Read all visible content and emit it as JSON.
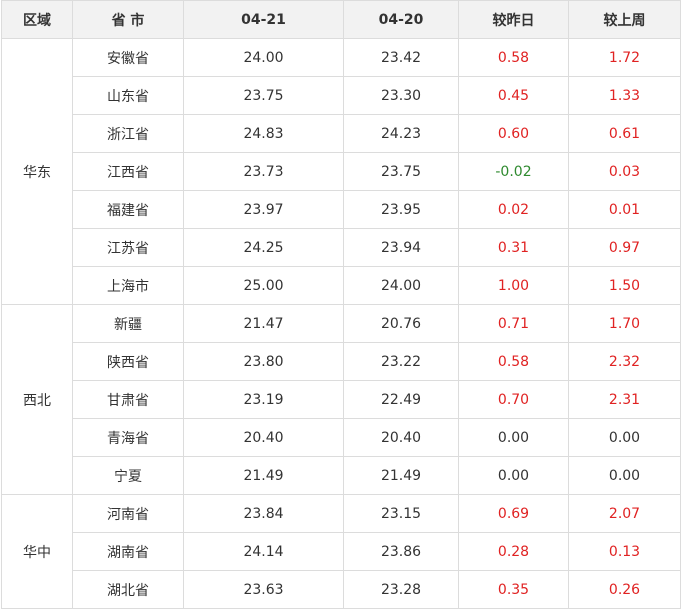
{
  "headers": [
    "区域",
    "省 市",
    "04-21",
    "04-20",
    "较昨日",
    "较上周"
  ],
  "colors": {
    "up": "#e02222",
    "down": "#2f8a2f",
    "flat": "#333333",
    "header_bg": "#f2f2f2",
    "border": "#dcdcdc"
  },
  "groups": [
    {
      "region": "华东",
      "rows": [
        {
          "province": "安徽省",
          "d0421": "24.00",
          "d0420": "23.42",
          "vs_yesterday": "0.58",
          "vs_last_week": "1.72"
        },
        {
          "province": "山东省",
          "d0421": "23.75",
          "d0420": "23.30",
          "vs_yesterday": "0.45",
          "vs_last_week": "1.33"
        },
        {
          "province": "浙江省",
          "d0421": "24.83",
          "d0420": "24.23",
          "vs_yesterday": "0.60",
          "vs_last_week": "0.61"
        },
        {
          "province": "江西省",
          "d0421": "23.73",
          "d0420": "23.75",
          "vs_yesterday": "-0.02",
          "vs_last_week": "0.03"
        },
        {
          "province": "福建省",
          "d0421": "23.97",
          "d0420": "23.95",
          "vs_yesterday": "0.02",
          "vs_last_week": "0.01"
        },
        {
          "province": "江苏省",
          "d0421": "24.25",
          "d0420": "23.94",
          "vs_yesterday": "0.31",
          "vs_last_week": "0.97"
        },
        {
          "province": "上海市",
          "d0421": "25.00",
          "d0420": "24.00",
          "vs_yesterday": "1.00",
          "vs_last_week": "1.50"
        }
      ]
    },
    {
      "region": "西北",
      "rows": [
        {
          "province": "新疆",
          "d0421": "21.47",
          "d0420": "20.76",
          "vs_yesterday": "0.71",
          "vs_last_week": "1.70"
        },
        {
          "province": "陕西省",
          "d0421": "23.80",
          "d0420": "23.22",
          "vs_yesterday": "0.58",
          "vs_last_week": "2.32"
        },
        {
          "province": "甘肃省",
          "d0421": "23.19",
          "d0420": "22.49",
          "vs_yesterday": "0.70",
          "vs_last_week": "2.31"
        },
        {
          "province": "青海省",
          "d0421": "20.40",
          "d0420": "20.40",
          "vs_yesterday": "0.00",
          "vs_last_week": "0.00"
        },
        {
          "province": "宁夏",
          "d0421": "21.49",
          "d0420": "21.49",
          "vs_yesterday": "0.00",
          "vs_last_week": "0.00"
        }
      ]
    },
    {
      "region": "华中",
      "rows": [
        {
          "province": "河南省",
          "d0421": "23.84",
          "d0420": "23.15",
          "vs_yesterday": "0.69",
          "vs_last_week": "2.07"
        },
        {
          "province": "湖南省",
          "d0421": "24.14",
          "d0420": "23.86",
          "vs_yesterday": "0.28",
          "vs_last_week": "0.13"
        },
        {
          "province": "湖北省",
          "d0421": "23.63",
          "d0420": "23.28",
          "vs_yesterday": "0.35",
          "vs_last_week": "0.26"
        }
      ]
    }
  ]
}
